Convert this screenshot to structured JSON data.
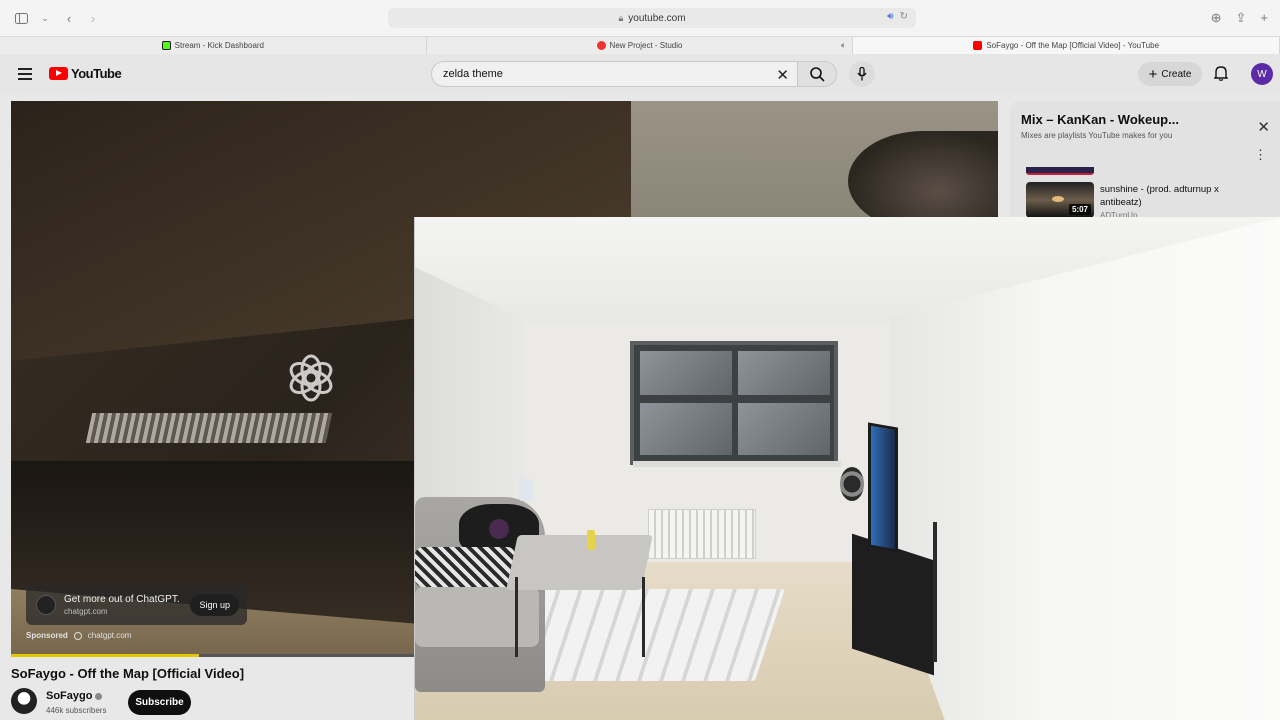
{
  "browser": {
    "url": "youtube.com",
    "tabs": [
      {
        "label": "Stream - Kick Dashboard",
        "favicon": "kick-icon"
      },
      {
        "label": "New Project - Studio",
        "favicon": "studio-icon"
      },
      {
        "label": "SoFaygo - Off the Map [Official Video] - YouTube",
        "favicon": "youtube-icon"
      }
    ]
  },
  "youtube": {
    "logo_text": "YouTube",
    "search": {
      "value": "zelda theme"
    },
    "create_label": "Create",
    "avatar_letter": "W"
  },
  "player": {
    "ad": {
      "title": "Get more out of ChatGPT.",
      "domain": "chatgpt.com",
      "cta": "Sign up",
      "sponsored_label": "Sponsored",
      "sponsor_domain": "chatgpt.com"
    },
    "progress": 0.19
  },
  "video": {
    "title": "SoFaygo - Off the Map [Official Video]",
    "channel": "SoFaygo",
    "subscribers": "446k subscribers",
    "subscribe_label": "Subscribe"
  },
  "mix": {
    "title": "Mix – KanKan - Wokeup...",
    "subtitle": "Mixes are playlists YouTube makes for you",
    "item": {
      "title": "sunshine - (prod. adturnup x antibeatz)",
      "duration": "5:07",
      "channel": "ADTurnUp"
    }
  },
  "colors": {
    "youtube_red": "#ff0000",
    "avatar_purple": "#5b2aa6",
    "progress_yellow": "#e5c700"
  }
}
